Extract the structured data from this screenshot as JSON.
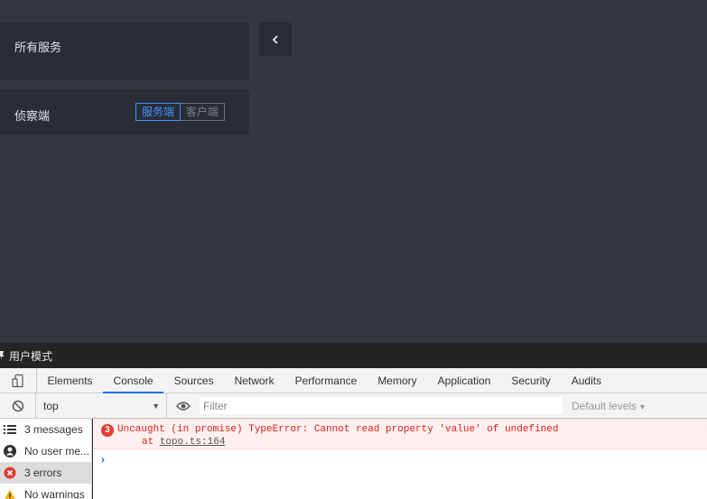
{
  "app": {
    "services_card": {
      "title": "所有服务"
    },
    "detect_card": {
      "title": "侦察端",
      "toggle": {
        "options": [
          "服务端",
          "客户端"
        ],
        "active_index": 0
      }
    },
    "collapse_button": {
      "icon": "chevron-left-icon"
    },
    "colors": {
      "background": "#333740",
      "card": "#292d35",
      "accent": "#3d92ff"
    }
  },
  "devtools": {
    "mode_bar": {
      "label": "用户模式"
    },
    "tabs": [
      {
        "label": "Elements"
      },
      {
        "label": "Console",
        "active": true
      },
      {
        "label": "Sources"
      },
      {
        "label": "Network"
      },
      {
        "label": "Performance"
      },
      {
        "label": "Memory"
      },
      {
        "label": "Application"
      },
      {
        "label": "Security"
      },
      {
        "label": "Audits"
      }
    ],
    "toolbar": {
      "context": "top",
      "filter_placeholder": "Filter",
      "levels": "Default levels"
    },
    "sidebar": [
      {
        "label": "3 messages",
        "icon": "list-icon"
      },
      {
        "label": "No user me...",
        "icon": "user-icon"
      },
      {
        "label": "3 errors",
        "icon": "error-icon",
        "selected": true
      },
      {
        "label": "No warnings",
        "icon": "warning-icon"
      }
    ],
    "console": {
      "error": {
        "count": "3",
        "message": "Uncaught (in promise) TypeError: Cannot read property 'value' of undefined",
        "stack_prefix": "at ",
        "stack_link": "topo.ts:164"
      },
      "prompt": "›"
    }
  }
}
